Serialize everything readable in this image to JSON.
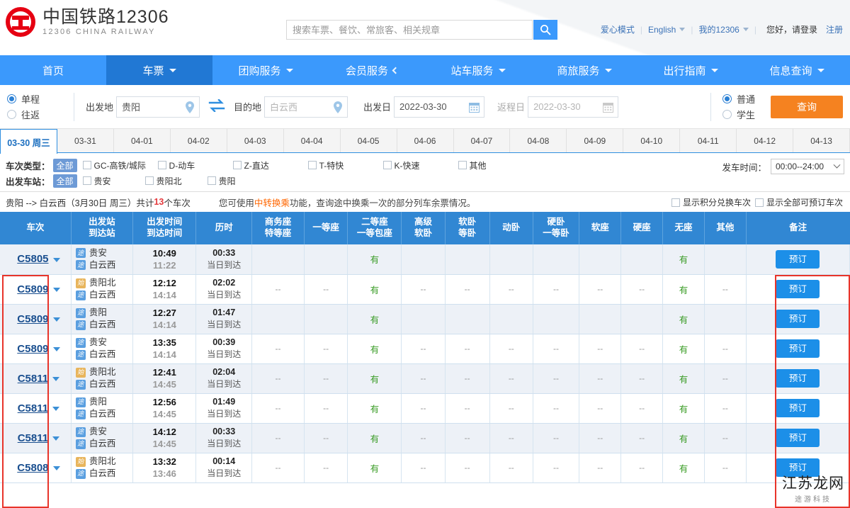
{
  "site": {
    "logo_cn": "中国铁路12306",
    "logo_en": "12306 CHINA RAILWAY"
  },
  "search": {
    "placeholder": "搜索车票、餐饮、常旅客、相关规章",
    "value": ""
  },
  "header_links": {
    "love_mode": "爱心模式",
    "language": "English",
    "my12306": "我的12306",
    "greeting": "您好，请登录",
    "register": "注册"
  },
  "nav": {
    "items": [
      {
        "label": "首页",
        "caret": false,
        "active": false
      },
      {
        "label": "车票",
        "caret": true,
        "active": true
      },
      {
        "label": "团购服务",
        "caret": true,
        "active": false
      },
      {
        "label": "会员服务",
        "caret": true,
        "active": false
      },
      {
        "label": "站车服务",
        "caret": true,
        "active": false
      },
      {
        "label": "商旅服务",
        "caret": true,
        "active": false
      },
      {
        "label": "出行指南",
        "caret": true,
        "active": false
      },
      {
        "label": "信息查询",
        "caret": true,
        "active": false
      }
    ]
  },
  "query": {
    "trip_oneway": "单程",
    "trip_roundtrip": "往返",
    "from_label": "出发地",
    "from_value": "贵阳",
    "to_label": "目的地",
    "to_value": "白云西",
    "depart_label": "出发日",
    "depart_value": "2022-03-30",
    "return_label": "返程日",
    "return_value": "2022-03-30",
    "type_normal": "普通",
    "type_student": "学生",
    "submit": "查询"
  },
  "date_tabs": [
    {
      "label": "03-30 周三",
      "active": true
    },
    {
      "label": "03-31",
      "active": false
    },
    {
      "label": "04-01",
      "active": false
    },
    {
      "label": "04-02",
      "active": false
    },
    {
      "label": "04-03",
      "active": false
    },
    {
      "label": "04-04",
      "active": false
    },
    {
      "label": "04-05",
      "active": false
    },
    {
      "label": "04-06",
      "active": false
    },
    {
      "label": "04-07",
      "active": false
    },
    {
      "label": "04-08",
      "active": false
    },
    {
      "label": "04-09",
      "active": false
    },
    {
      "label": "04-10",
      "active": false
    },
    {
      "label": "04-11",
      "active": false
    },
    {
      "label": "04-12",
      "active": false
    },
    {
      "label": "04-13",
      "active": false
    }
  ],
  "filters": {
    "train_type_label": "车次类型：",
    "train_type_all": "全部",
    "train_types": [
      "GC-高铁/城际",
      "D-动车",
      "Z-直达",
      "T-特快",
      "K-快速",
      "其他"
    ],
    "station_label": "出发车站：",
    "station_all": "全部",
    "stations": [
      "贵安",
      "贵阳北",
      "贵阳"
    ],
    "depart_time_label": "发车时间：",
    "depart_time_value": "00:00--24:00"
  },
  "summary": {
    "route": "贵阳 --> 白云西（3月30日 周三）共计",
    "count": "13",
    "count_suffix": "个车次",
    "tip_prefix": "您可使用",
    "tip_highlight": "中转换乘",
    "tip_suffix": "功能，查询途中换乘一次的部分列车余票情况。",
    "show_points": "显示积分兑换车次",
    "show_all": "显示全部可预订车次"
  },
  "table": {
    "headers": [
      {
        "line1": "车次",
        "line2": ""
      },
      {
        "line1": "出发站",
        "line2": "到达站"
      },
      {
        "line1": "出发时间",
        "line2": "到达时间",
        "sort": "both"
      },
      {
        "line1": "历时",
        "line2": "",
        "sort": "up-on"
      },
      {
        "line1": "商务座",
        "line2": "特等座"
      },
      {
        "line1": "一等座",
        "line2": ""
      },
      {
        "line1": "二等座",
        "line2": "一等包座"
      },
      {
        "line1": "高级",
        "line2": "软卧"
      },
      {
        "line1": "软卧",
        "line2": "等卧"
      },
      {
        "line1": "动卧",
        "line2": ""
      },
      {
        "line1": "硬卧",
        "line2": "一等卧"
      },
      {
        "line1": "软座",
        "line2": ""
      },
      {
        "line1": "硬座",
        "line2": ""
      },
      {
        "line1": "无座",
        "line2": ""
      },
      {
        "line1": "其他",
        "line2": ""
      },
      {
        "line1": "备注",
        "line2": ""
      }
    ],
    "book_label": "预订",
    "yes_label": "有",
    "dash_label": "--",
    "badge_pass": "途",
    "badge_start": "始",
    "arrive_same_day": "当日到达",
    "rows": [
      {
        "train": "C5805",
        "from": "贵安",
        "to": "白云西",
        "from_badge": "途",
        "to_badge": "途",
        "depart": "10:49",
        "arrive": "11:22",
        "duration": "00:33",
        "arrive_note": "当日到达",
        "seats": [
          "",
          "",
          "有",
          "",
          "",
          "",
          "",
          "",
          "",
          "有",
          ""
        ]
      },
      {
        "train": "C5809",
        "from": "贵阳北",
        "to": "白云西",
        "from_badge": "始",
        "to_badge": "途",
        "depart": "12:12",
        "arrive": "14:14",
        "duration": "02:02",
        "arrive_note": "当日到达",
        "seats": [
          "--",
          "--",
          "有",
          "--",
          "--",
          "--",
          "--",
          "--",
          "--",
          "有",
          "--"
        ]
      },
      {
        "train": "C5809",
        "from": "贵阳",
        "to": "白云西",
        "from_badge": "途",
        "to_badge": "途",
        "depart": "12:27",
        "arrive": "14:14",
        "duration": "01:47",
        "arrive_note": "当日到达",
        "seats": [
          "",
          "",
          "有",
          "",
          "",
          "",
          "",
          "",
          "",
          "有",
          ""
        ]
      },
      {
        "train": "C5809",
        "from": "贵安",
        "to": "白云西",
        "from_badge": "途",
        "to_badge": "途",
        "depart": "13:35",
        "arrive": "14:14",
        "duration": "00:39",
        "arrive_note": "当日到达",
        "seats": [
          "--",
          "--",
          "有",
          "--",
          "--",
          "--",
          "--",
          "--",
          "--",
          "有",
          "--"
        ]
      },
      {
        "train": "C5811",
        "from": "贵阳北",
        "to": "白云西",
        "from_badge": "始",
        "to_badge": "途",
        "depart": "12:41",
        "arrive": "14:45",
        "duration": "02:04",
        "arrive_note": "当日到达",
        "seats": [
          "--",
          "--",
          "有",
          "--",
          "--",
          "--",
          "--",
          "--",
          "--",
          "有",
          "--"
        ]
      },
      {
        "train": "C5811",
        "from": "贵阳",
        "to": "白云西",
        "from_badge": "途",
        "to_badge": "途",
        "depart": "12:56",
        "arrive": "14:45",
        "duration": "01:49",
        "arrive_note": "当日到达",
        "seats": [
          "--",
          "--",
          "有",
          "--",
          "--",
          "--",
          "--",
          "--",
          "--",
          "有",
          "--"
        ]
      },
      {
        "train": "C5811",
        "from": "贵安",
        "to": "白云西",
        "from_badge": "途",
        "to_badge": "途",
        "depart": "14:12",
        "arrive": "14:45",
        "duration": "00:33",
        "arrive_note": "当日到达",
        "seats": [
          "--",
          "--",
          "有",
          "--",
          "--",
          "--",
          "--",
          "--",
          "--",
          "有",
          "--"
        ]
      },
      {
        "train": "C5808",
        "from": "贵阳北",
        "to": "白云西",
        "from_badge": "始",
        "to_badge": "途",
        "depart": "13:32",
        "arrive": "13:46",
        "duration": "00:14",
        "arrive_note": "当日到达",
        "seats": [
          "--",
          "--",
          "有",
          "--",
          "--",
          "--",
          "--",
          "--",
          "--",
          "有",
          "--"
        ]
      }
    ]
  },
  "watermark": {
    "line1": "江苏龙网",
    "line2": "途游科技"
  }
}
